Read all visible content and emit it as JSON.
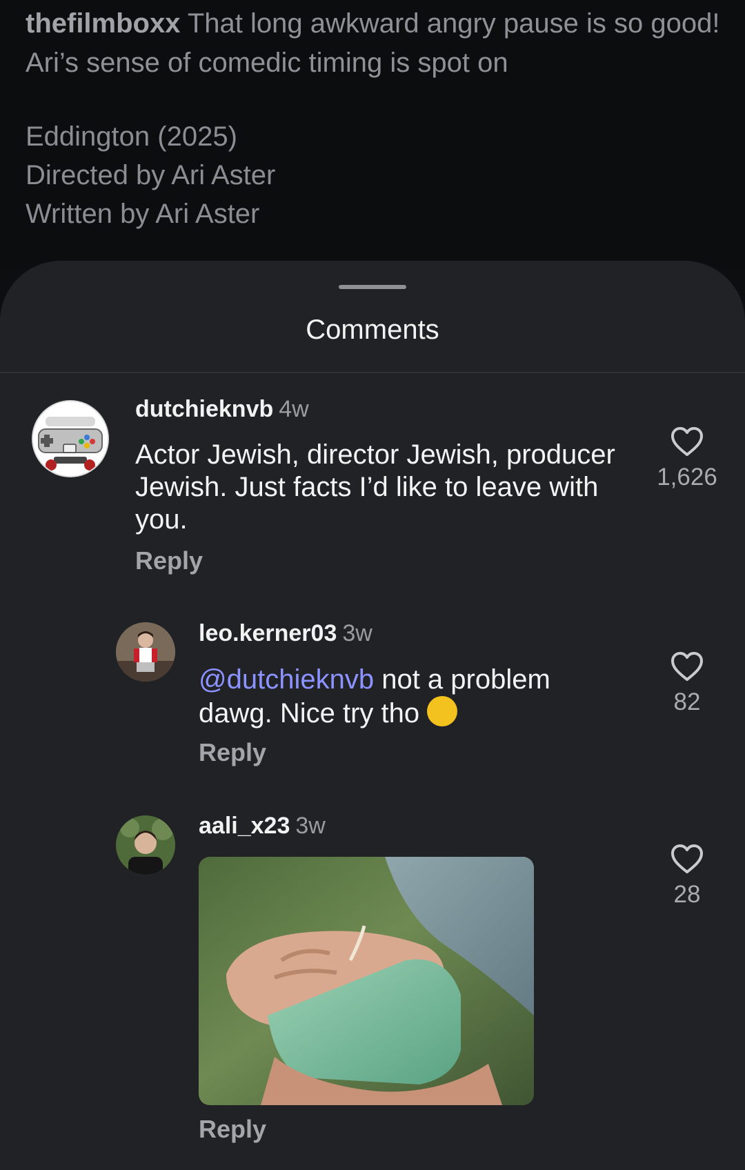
{
  "post": {
    "caption_user": "thefilmboxx",
    "caption_text": "That long awkward angry pause is so good! Ari’s sense of comedic timing is spot on",
    "credits": [
      "Eddington (2025)",
      "Directed by  Ari Aster",
      "Written by  Ari Aster"
    ]
  },
  "sheet": {
    "title": "Comments"
  },
  "comments": [
    {
      "username": "dutchieknvb",
      "time": "4w",
      "text": "Actor Jewish, director Jewish, producer Jewish. Just facts I’d like to leave with you.",
      "reply_label": "Reply",
      "likes": "1,626",
      "avatar_icon": "game-controller-avatar"
    },
    {
      "username": "leo.kerner03",
      "time": "3w",
      "mention": "@dutchieknvb",
      "text": " not a problem dawg. Nice try tho ",
      "emoji": "☺️",
      "reply_label": "Reply",
      "likes": "82",
      "avatar_icon": "person-avatar"
    },
    {
      "username": "aali_x23",
      "time": "3w",
      "media": "gif-hands-holding-green-soap",
      "reply_label": "Reply",
      "likes": "28",
      "avatar_icon": "person-avatar"
    }
  ],
  "icons": {
    "like": "heart-outline-icon"
  },
  "colors": {
    "sheet_bg": "#202226",
    "page_bg": "#0c0d0f",
    "mention": "#8c93ff"
  }
}
